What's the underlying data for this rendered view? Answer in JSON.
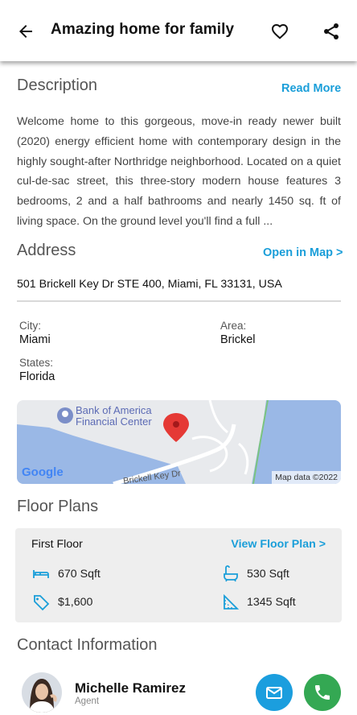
{
  "header": {
    "title": "Amazing home for family",
    "back_icon": "arrow-left-icon",
    "favorite_icon": "heart-outline-icon",
    "share_icon": "share-icon"
  },
  "description": {
    "heading": "Description",
    "read_more": "Read More",
    "text": "Welcome home to this gorgeous, move-in ready newer built (2020) energy efficient home with contemporary design in the highly sought-after Northridge neighborhood. Located on a quiet cul-de-sac street, this three-story modern house features 3 bedrooms, 2 and a half bathrooms and nearly 1450 sq. ft of living space. On the ground level you'll find a full ..."
  },
  "address": {
    "heading": "Address",
    "open_map": "Open in Map >",
    "line": "501 Brickell Key Dr STE 400, Miami, FL 33131, USA",
    "city_label": "City:",
    "city": "Miami",
    "area_label": "Area:",
    "area": "Brickel",
    "states_label": "States:",
    "state": "Florida"
  },
  "map": {
    "poi_line1": "Bank of America",
    "poi_line2": "Financial Center",
    "street": "Brickell Key Dr",
    "logo": "Google",
    "attribution": "Map data ©2022"
  },
  "floor_plans": {
    "heading": "Floor Plans",
    "floor_name": "First Floor",
    "view_link": "View Floor Plan >",
    "features": [
      {
        "icon": "bed-icon",
        "value": "670 Sqft"
      },
      {
        "icon": "bathtub-icon",
        "value": "530 Sqft"
      },
      {
        "icon": "price-tag-icon",
        "value": "$1,600"
      },
      {
        "icon": "ruler-triangle-icon",
        "value": "1345 Sqft"
      }
    ]
  },
  "contact": {
    "heading": "Contact Information",
    "agent_name": "Michelle Ramirez",
    "agent_role": "Agent",
    "email_icon": "mail-icon",
    "call_icon": "phone-icon"
  },
  "colors": {
    "accent": "#1a9ed9",
    "email_button": "#1b9ede",
    "call_button": "#34a853",
    "card_bg": "#eeeeee"
  }
}
